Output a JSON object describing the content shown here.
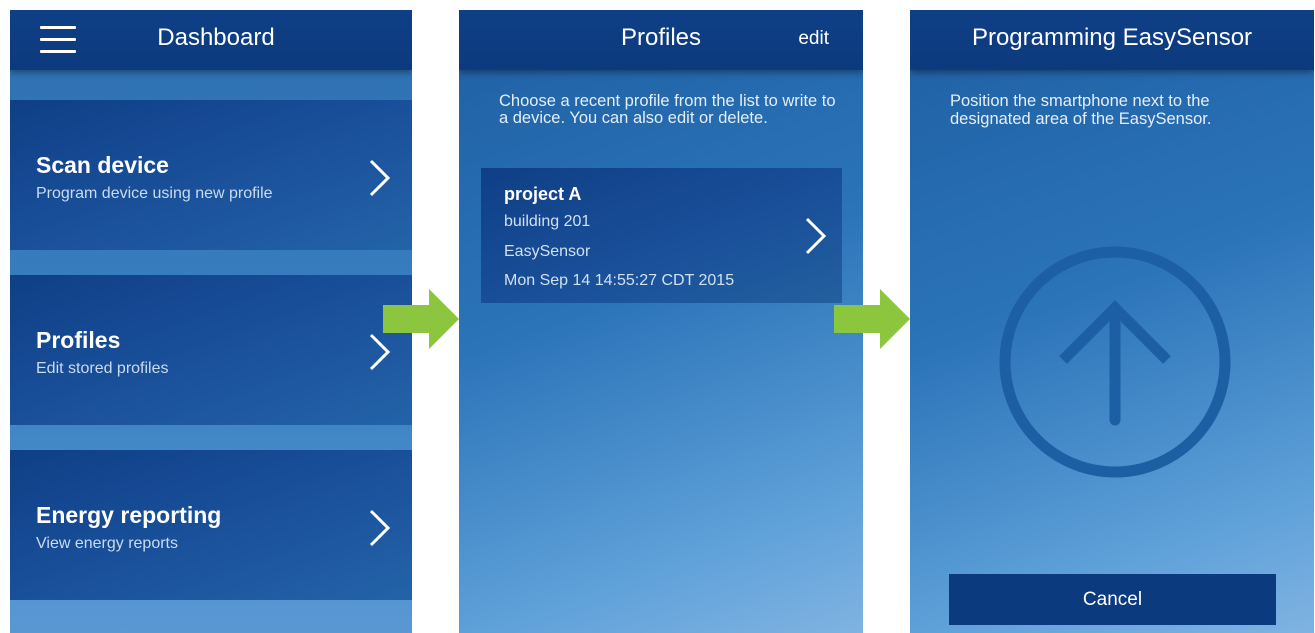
{
  "colors": {
    "header": "#0c3a7e",
    "card": "#0f3f86",
    "flow_arrow": "#8cc63f",
    "accent_circle": "#1c5fa3"
  },
  "dashboard": {
    "title": "Dashboard",
    "cards": [
      {
        "title": "Scan device",
        "subtitle": "Program device using new profile",
        "icon": "chevron-right-icon"
      },
      {
        "title": "Profiles",
        "subtitle": "Edit stored profiles",
        "icon": "chevron-right-icon"
      },
      {
        "title": "Energy reporting",
        "subtitle": "View energy reports",
        "icon": "chevron-right-icon"
      }
    ]
  },
  "profiles": {
    "title": "Profiles",
    "edit_label": "edit",
    "intro": "Choose a recent profile from the list to write to a device. You can also edit or delete.",
    "items": [
      {
        "name": "project A",
        "building": "building 201",
        "device": "EasySensor",
        "timestamp": "Mon Sep 14 14:55:27 CDT 2015"
      }
    ]
  },
  "programming": {
    "title": "Programming EasySensor",
    "instructions": "Position the smartphone next to the designated area of the EasySensor.",
    "icon": "upload-arrow-icon",
    "cancel_label": "Cancel"
  }
}
